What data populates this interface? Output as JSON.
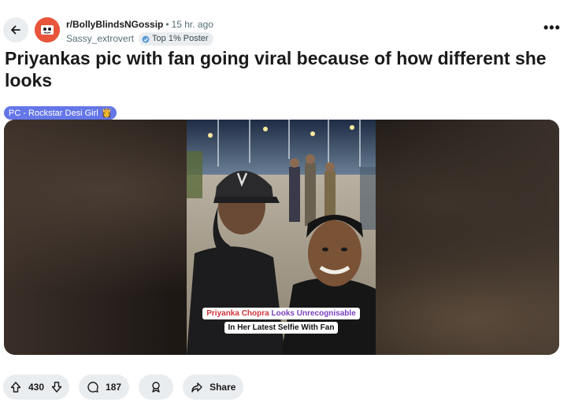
{
  "post": {
    "subreddit": "r/BollyBlindsNGossip",
    "separator": "•",
    "time": "15 hr. ago",
    "author": "Sassy_extrovert",
    "author_badge": "Top 1% Poster",
    "title": "Priyankas pic with fan going viral because of how different she looks",
    "flair": "PC - Rockstar Desi Girl",
    "flair_emoji": "👸",
    "more_label": "•••"
  },
  "image_caption": {
    "name": "Priyanka Chopra",
    "looks": "Looks",
    "unrecognisable": "Unrecognisable",
    "line2": "In Her Latest Selfie With Fan"
  },
  "actions": {
    "upvotes": "430",
    "comments": "187",
    "share": "Share"
  },
  "colors": {
    "accent": "#6577e8",
    "pill_bg": "#eaedef",
    "avatar_bg": "#e8553b"
  }
}
